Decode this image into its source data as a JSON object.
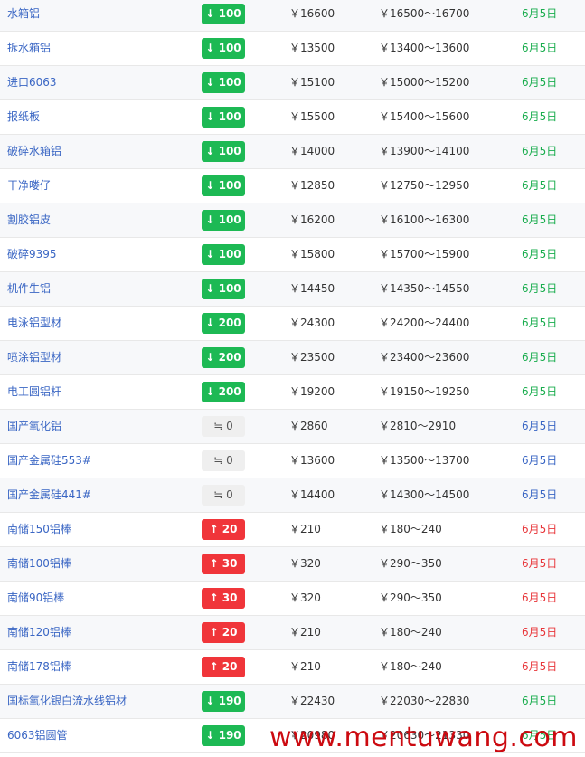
{
  "rows": [
    {
      "name": "水箱铝",
      "trend": "down",
      "change": "↓ 100",
      "price": "￥16600",
      "range": "￥16500～16700",
      "date": "6月5日"
    },
    {
      "name": "拆水箱铝",
      "trend": "down",
      "change": "↓ 100",
      "price": "￥13500",
      "range": "￥13400～13600",
      "date": "6月5日"
    },
    {
      "name": "进口6063",
      "trend": "down",
      "change": "↓ 100",
      "price": "￥15100",
      "range": "￥15000～15200",
      "date": "6月5日"
    },
    {
      "name": "报纸板",
      "trend": "down",
      "change": "↓ 100",
      "price": "￥15500",
      "range": "￥15400～15600",
      "date": "6月5日"
    },
    {
      "name": "破碎水箱铝",
      "trend": "down",
      "change": "↓ 100",
      "price": "￥14000",
      "range": "￥13900～14100",
      "date": "6月5日"
    },
    {
      "name": "干净喽仔",
      "trend": "down",
      "change": "↓ 100",
      "price": "￥12850",
      "range": "￥12750～12950",
      "date": "6月5日"
    },
    {
      "name": "割胶铝皮",
      "trend": "down",
      "change": "↓ 100",
      "price": "￥16200",
      "range": "￥16100～16300",
      "date": "6月5日"
    },
    {
      "name": "破碎9395",
      "trend": "down",
      "change": "↓ 100",
      "price": "￥15800",
      "range": "￥15700～15900",
      "date": "6月5日"
    },
    {
      "name": "机件生铝",
      "trend": "down",
      "change": "↓ 100",
      "price": "￥14450",
      "range": "￥14350～14550",
      "date": "6月5日"
    },
    {
      "name": "电泳铝型材",
      "trend": "down",
      "change": "↓ 200",
      "price": "￥24300",
      "range": "￥24200～24400",
      "date": "6月5日"
    },
    {
      "name": "喷涂铝型材",
      "trend": "down",
      "change": "↓ 200",
      "price": "￥23500",
      "range": "￥23400～23600",
      "date": "6月5日"
    },
    {
      "name": "电工圆铝杆",
      "trend": "down",
      "change": "↓ 200",
      "price": "￥19200",
      "range": "￥19150～19250",
      "date": "6月5日"
    },
    {
      "name": "国产氧化铝",
      "trend": "flat",
      "change": "≒ 0",
      "price": "￥2860",
      "range": "￥2810～2910",
      "date": "6月5日"
    },
    {
      "name": "国产金属硅553#",
      "trend": "flat",
      "change": "≒ 0",
      "price": "￥13600",
      "range": "￥13500～13700",
      "date": "6月5日"
    },
    {
      "name": "国产金属硅441#",
      "trend": "flat",
      "change": "≒ 0",
      "price": "￥14400",
      "range": "￥14300～14500",
      "date": "6月5日"
    },
    {
      "name": "南储150铝棒",
      "trend": "up",
      "change": "↑ 20",
      "price": "￥210",
      "range": "￥180～240",
      "date": "6月5日"
    },
    {
      "name": "南储100铝棒",
      "trend": "up",
      "change": "↑ 30",
      "price": "￥320",
      "range": "￥290～350",
      "date": "6月5日"
    },
    {
      "name": "南储90铝棒",
      "trend": "up",
      "change": "↑ 30",
      "price": "￥320",
      "range": "￥290～350",
      "date": "6月5日"
    },
    {
      "name": "南储120铝棒",
      "trend": "up",
      "change": "↑ 20",
      "price": "￥210",
      "range": "￥180～240",
      "date": "6月5日"
    },
    {
      "name": "南储178铝棒",
      "trend": "up",
      "change": "↑ 20",
      "price": "￥210",
      "range": "￥180～240",
      "date": "6月5日"
    },
    {
      "name": "国标氧化银白流水线铝材",
      "trend": "down",
      "change": "↓ 190",
      "price": "￥22430",
      "range": "￥22030～22830",
      "date": "6月5日"
    },
    {
      "name": "6063铝圆管",
      "trend": "down",
      "change": "↓ 190",
      "price": "￥20980",
      "range": "￥20630～21330",
      "date": "6月5日"
    }
  ],
  "watermark": "www.mentuwang.com",
  "colors": {
    "down": "#1db954",
    "up": "#f0353a",
    "flat": "#efefef",
    "link": "#3a66c4",
    "watermark": "#cc0a10"
  }
}
